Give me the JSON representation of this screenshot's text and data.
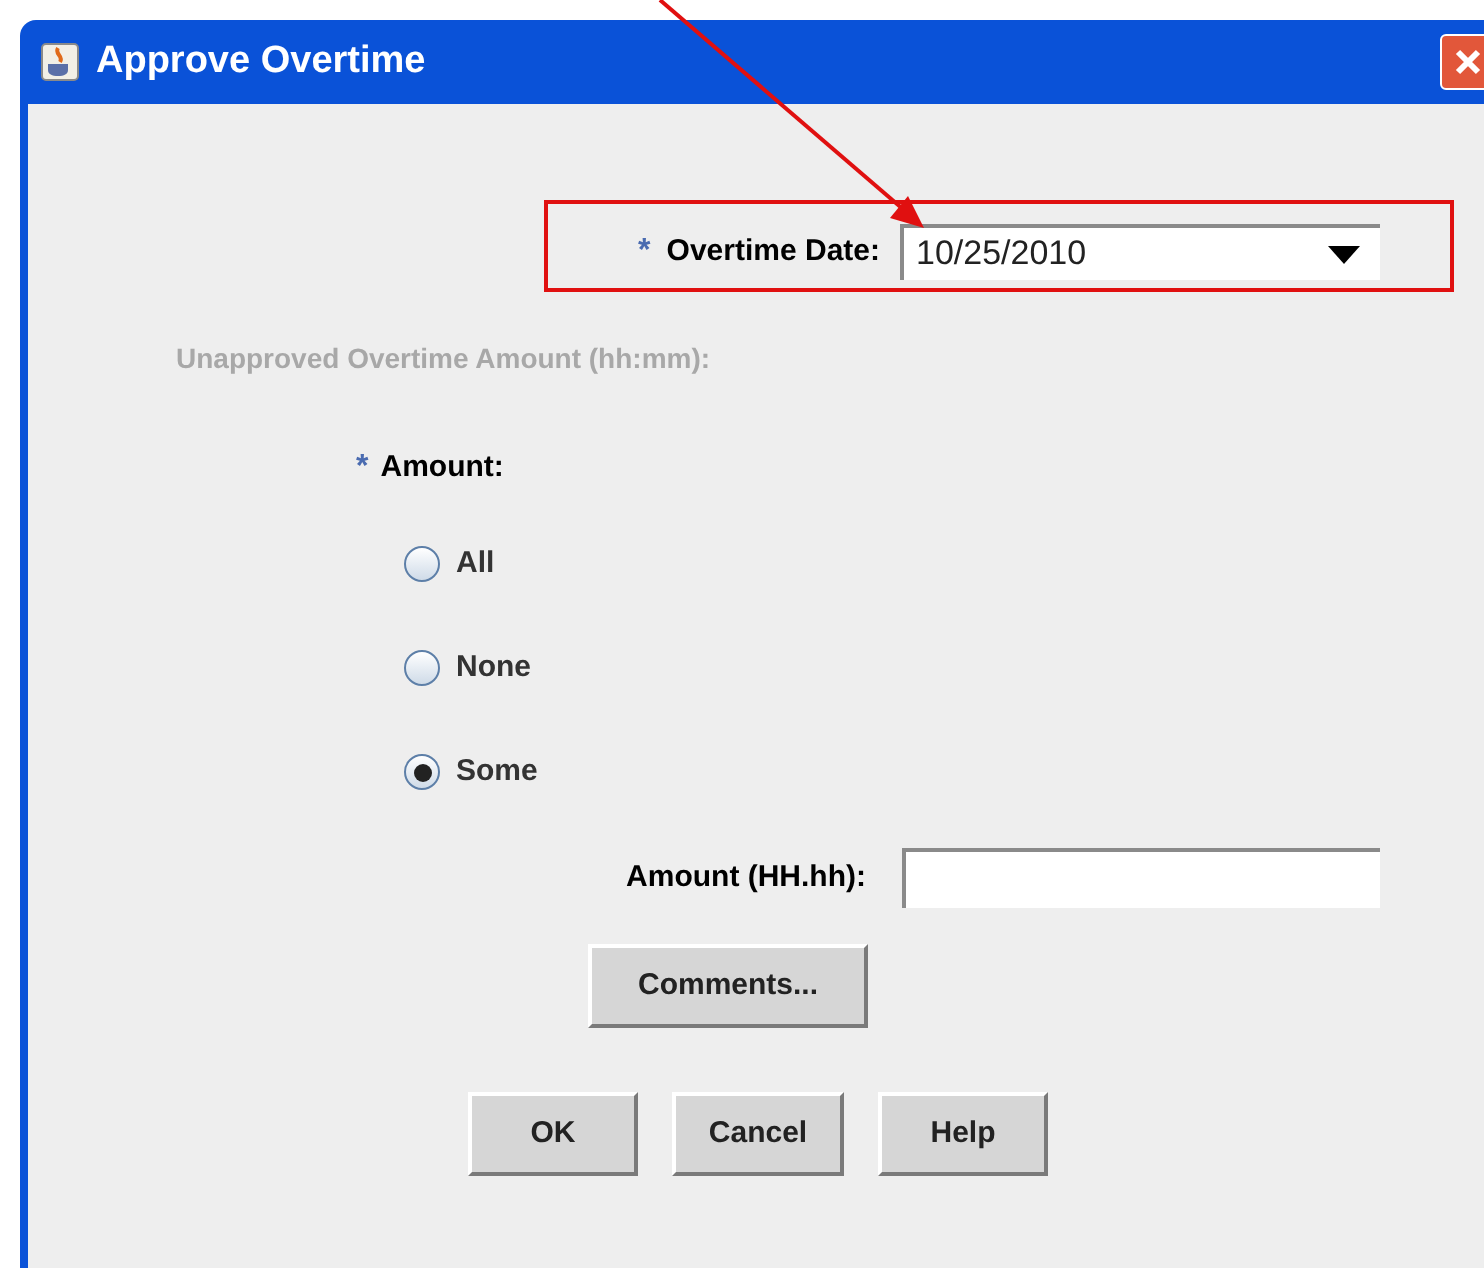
{
  "window": {
    "title": "Approve Overtime"
  },
  "overtime_date": {
    "required_mark": "*",
    "label": "Overtime Date:",
    "value": "10/25/2010"
  },
  "unapproved_label": "Unapproved Overtime Amount (hh:mm):",
  "amount": {
    "required_mark": "*",
    "label": "Amount:"
  },
  "options": [
    {
      "label": "All",
      "selected": false
    },
    {
      "label": "None",
      "selected": false
    },
    {
      "label": "Some",
      "selected": true
    }
  ],
  "amount_field": {
    "label": "Amount (HH.hh):"
  },
  "comments_button": "Comments...",
  "buttons": [
    "OK",
    "Cancel",
    "Help"
  ]
}
